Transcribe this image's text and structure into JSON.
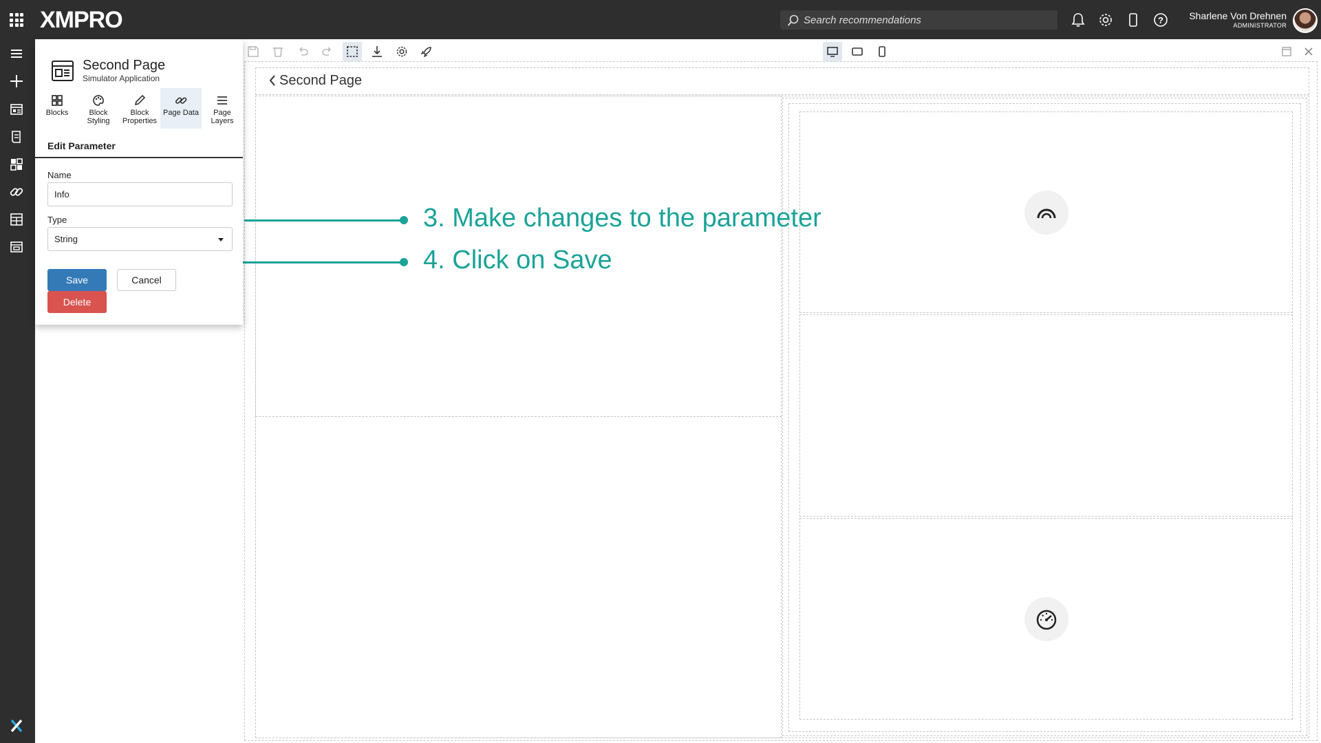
{
  "topbar": {
    "logo": "XMPRO",
    "search_placeholder": "Search recommendations",
    "user_name": "Sharlene Von Drehnen",
    "user_role": "ADMINISTRATOR"
  },
  "rail": {
    "icons": [
      "menu-icon",
      "plus-icon",
      "apps-list-icon",
      "recommendations-icon",
      "dashboard-icon",
      "link-icon",
      "data-stream-icon",
      "page-icon",
      "xmpro-logo-icon"
    ]
  },
  "panel": {
    "page_title": "Second Page",
    "page_subtitle": "Simulator Application",
    "tabs": [
      {
        "label": "Blocks",
        "icon": "blocks-icon"
      },
      {
        "label": "Block Styling",
        "icon": "palette-icon"
      },
      {
        "label": "Block Properties",
        "icon": "pencil-icon"
      },
      {
        "label": "Page Data",
        "icon": "link-icon"
      },
      {
        "label": "Page Layers",
        "icon": "layers-icon"
      }
    ],
    "active_tab": "Page Data",
    "section_title": "Edit Parameter",
    "name_label": "Name",
    "name_value": "Info",
    "type_label": "Type",
    "type_value": "String",
    "save_label": "Save",
    "cancel_label": "Cancel",
    "delete_label": "Delete"
  },
  "canvas": {
    "title": "Second Page"
  },
  "callouts": {
    "step3": "3. Make changes to the parameter",
    "step4": "4. Click on Save"
  },
  "colors": {
    "topbar": "#2e2e2e",
    "save": "#337ab7",
    "delete": "#d9534f",
    "callout": "#1ba397",
    "active_tab": "#e8eff7"
  }
}
